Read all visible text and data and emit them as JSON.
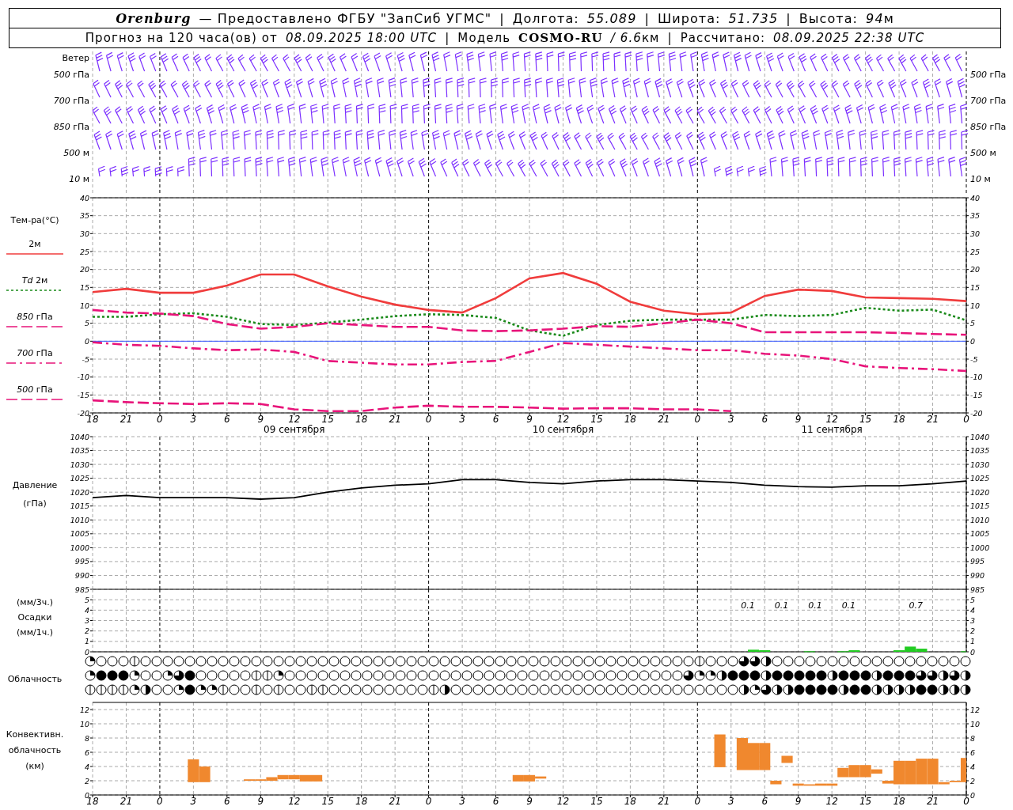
{
  "header": {
    "lines": [
      [
        {
          "kind": "station",
          "text": "Orenburg"
        },
        {
          "kind": "text",
          "text": "— Предоставлено ФГБУ \"ЗапСиб УГМС\""
        },
        {
          "kind": "separator",
          "text": "|"
        },
        {
          "kind": "text",
          "text": "Долгота:"
        },
        {
          "kind": "value",
          "text": "55.089"
        },
        {
          "kind": "separator",
          "text": "|"
        },
        {
          "kind": "text",
          "text": "Широта:"
        },
        {
          "kind": "value",
          "text": "51.735"
        },
        {
          "kind": "separator",
          "text": "|"
        },
        {
          "kind": "text",
          "text": "Высота:"
        },
        {
          "kind": "value",
          "text": "94"
        },
        {
          "kind": "unit",
          "text": "м"
        }
      ],
      [
        {
          "kind": "text",
          "text": "Прогноз на 120 часа(ов) от"
        },
        {
          "kind": "value",
          "text": "08.09.2025 18:00 UTC"
        },
        {
          "kind": "separator",
          "text": "|"
        },
        {
          "kind": "text",
          "text": "Модель"
        },
        {
          "kind": "model",
          "text": "COSMO-RU"
        },
        {
          "kind": "value",
          "text": "/ 6.6"
        },
        {
          "kind": "unit",
          "text": "км"
        },
        {
          "kind": "separator",
          "text": "|"
        },
        {
          "kind": "text",
          "text": "Рассчитано:"
        },
        {
          "kind": "value",
          "text": "08.09.2025 22:38 UTC"
        }
      ]
    ]
  },
  "wind": {
    "title": "Ветер",
    "levels": [
      "*500* гПа",
      "*700* гПа",
      "*850* гПа",
      "*500* м",
      "*10* м"
    ],
    "right_levels": [
      "*500* гПа",
      "*700* гПа",
      "*850* гПа",
      "*500* м",
      "*10* м"
    ]
  },
  "temperature": {
    "left_axis": [
      "40",
      "35",
      "30",
      "25",
      "20",
      "15",
      "10",
      "5",
      "0",
      "-5",
      "-10",
      "-15",
      "-20"
    ],
    "right_axis": [
      "40",
      "35",
      "30",
      "25",
      "20",
      "15",
      "10",
      "5",
      "0",
      "-5",
      "-10",
      "-15",
      "-20"
    ],
    "chart_data": {
      "type": "line",
      "title": "Тем-ра(°C)",
      "categories": [
        "18",
        "21",
        "0",
        "3",
        "6",
        "9",
        "12",
        "15",
        "18",
        "21",
        "0",
        "3",
        "6",
        "9",
        "12",
        "15",
        "18",
        "21",
        "0",
        "3",
        "6",
        "9",
        "12",
        "15",
        "18",
        "21",
        "0"
      ],
      "ylim": [
        -20,
        40
      ],
      "series": [
        {
          "name": "2м",
          "line_style": "solid",
          "color": "#f03c3c",
          "values": [
            13.7,
            14.6,
            13.5,
            13.5,
            15.5,
            18.6,
            18.6,
            15.3,
            12.4,
            10.2,
            8.7,
            8,
            12,
            17.5,
            19,
            16,
            11,
            8.5,
            7.5,
            8,
            12.6,
            14.4,
            14,
            12.2,
            12,
            11.8,
            11.2
          ]
        },
        {
          "name": "*Td* 2м",
          "line_style": "dotted",
          "color": "#1a8a1a",
          "values": [
            6.8,
            6.8,
            7.5,
            7.8,
            6.8,
            4.8,
            4.5,
            5.2,
            6,
            7,
            7.5,
            7.3,
            6.5,
            3,
            1.5,
            4.5,
            5.7,
            6,
            6,
            6,
            7.3,
            7,
            7.3,
            9.3,
            8.5,
            8.8,
            5.8
          ]
        },
        {
          "name": "*850* гПа",
          "line_style": "dashed",
          "color": "#e8147a",
          "values": [
            8.7,
            8,
            7.7,
            7,
            4.8,
            3.5,
            4,
            5,
            4.5,
            4,
            4,
            3,
            2.8,
            3,
            3.5,
            4.2,
            4,
            5,
            6,
            5,
            2.5,
            2.5,
            2.5,
            2.5,
            2.3,
            2,
            1.8
          ]
        },
        {
          "name": "*700* гПа",
          "line_style": "dashdot",
          "color": "#e8147a",
          "values": [
            -0.3,
            -1,
            -1.3,
            -2,
            -2.5,
            -2.3,
            -3,
            -5.5,
            -6,
            -6.5,
            -6.5,
            -5.8,
            -5.5,
            -3,
            -0.5,
            -1,
            -1.5,
            -2,
            -2.5,
            -2.5,
            -3.5,
            -4,
            -5,
            -7,
            -7.5,
            -7.8,
            -8.3
          ]
        },
        {
          "name": "*500* гПа",
          "line_style": "dashed",
          "color": "#e8147a",
          "values": [
            -16.5,
            -17,
            -17.3,
            -17.5,
            -17.3,
            -17.5,
            -19,
            -19.5,
            -19.5,
            -18.5,
            -18,
            -18.3,
            -18.3,
            -18.5,
            -18.8,
            -18.7,
            -18.7,
            -19,
            -19,
            -19.5,
            null,
            null,
            null,
            null,
            null,
            null,
            null
          ]
        }
      ],
      "yticks": [
        -20,
        -15,
        -10,
        -5,
        0,
        5,
        10,
        15,
        20,
        25,
        30,
        35,
        40
      ],
      "grid": true,
      "ref_lines": [
        {
          "axis": "y",
          "value": 0,
          "color": "#3355ff"
        }
      ],
      "annotations": [
        "09 сентября",
        "10 сентября",
        "11 сентября"
      ]
    }
  },
  "pressure": {
    "labels": [
      "Давление",
      "(гПа)"
    ],
    "right_axis": [
      "1040",
      "1035",
      "1030",
      "1025",
      "1020",
      "1015",
      "1010",
      "1005",
      "1000",
      "995",
      "990",
      "985"
    ],
    "chart_data": {
      "type": "line",
      "categories": [
        null,
        null,
        null,
        null,
        null,
        null,
        null,
        null,
        null,
        null,
        null,
        null,
        null,
        null,
        null,
        null,
        null,
        null,
        null,
        null,
        null,
        null,
        null,
        null,
        null,
        null,
        null
      ],
      "ylim": [
        985,
        1040
      ],
      "grid": true,
      "series": [
        {
          "color": "#000000",
          "values": [
            1018,
            1018.8,
            1018,
            1018,
            1018,
            1017.5,
            1018,
            1020,
            1021.5,
            1022.5,
            1023,
            1024.5,
            1024.5,
            1023.5,
            1023,
            1024,
            1024.5,
            1024.5,
            1024,
            1023.5,
            1022.5,
            1022,
            1021.8,
            1022.3,
            1022.3,
            1023,
            1024
          ]
        }
      ],
      "yticks": [
        985,
        990,
        995,
        1000,
        1005,
        1010,
        1015,
        1020,
        1025,
        1030,
        1035,
        1040
      ]
    }
  },
  "precipitation": {
    "labels": [
      "(мм/3ч.)",
      "Осадки",
      "(мм/1ч.)"
    ],
    "right_axis": [
      "5",
      "4",
      "3",
      "2",
      "1",
      "0"
    ],
    "chart_data": {
      "type": "bar",
      "categories": [
        null,
        null,
        null,
        null,
        null,
        null,
        null,
        null,
        null,
        null,
        null,
        null,
        null,
        null,
        null,
        null,
        null,
        null,
        null,
        null,
        null,
        null,
        null,
        null,
        null,
        null,
        null,
        null,
        null,
        null,
        null,
        null,
        null,
        null,
        null,
        null,
        null,
        null,
        null,
        null,
        null,
        null,
        null,
        null,
        null,
        null,
        null,
        null,
        null,
        null,
        null,
        null,
        null,
        null,
        null,
        null,
        null,
        null,
        null,
        null,
        null,
        null,
        null,
        null,
        null,
        null,
        null,
        null,
        null,
        null,
        null,
        null,
        null,
        null,
        null,
        null,
        null,
        null,
        null
      ],
      "ylim": [
        0,
        6
      ],
      "grid": true,
      "series": [
        {
          "color": "#22cc22",
          "values": [
            0,
            0,
            0,
            0,
            0,
            0,
            0,
            0,
            0,
            0,
            0,
            0,
            0,
            0,
            0,
            0,
            0,
            0,
            0,
            0,
            0,
            0,
            0,
            0,
            0,
            0,
            0,
            0,
            0,
            0,
            0,
            0,
            0,
            0,
            0,
            0,
            0,
            0,
            0,
            0,
            0,
            0,
            0,
            0,
            0,
            0,
            0,
            0,
            0,
            0,
            0,
            0,
            0,
            0,
            0,
            0,
            0,
            0,
            0,
            0.2,
            0.15,
            0,
            0,
            0,
            0.05,
            0,
            0,
            0.05,
            0.15,
            0,
            0,
            0,
            0.15,
            0.5,
            0.3,
            0,
            0,
            0,
            0.05
          ]
        }
      ],
      "yticks": [
        0,
        1,
        2,
        3,
        4,
        5
      ],
      "annotations": [
        "0.1",
        "0.1",
        "0.1",
        "0.1",
        "0.7"
      ]
    }
  },
  "clouds": {
    "label": "Облачность",
    "rows": [
      {
        "cells": [
          {
            "kind": "quarter"
          },
          {
            "kind": "clear"
          },
          {
            "kind": "clear"
          },
          {
            "kind": "clear"
          },
          {
            "kind": "few"
          },
          {
            "kind": "clear"
          },
          {
            "kind": "clear"
          },
          {
            "kind": "clear"
          },
          {
            "kind": "clear"
          },
          {
            "kind": "clear"
          },
          {
            "kind": "clear"
          },
          {
            "kind": "clear"
          },
          {
            "kind": "clear"
          },
          {
            "kind": "clear"
          },
          {
            "kind": "clear"
          },
          {
            "kind": "clear"
          },
          {
            "kind": "clear"
          },
          {
            "kind": "clear"
          },
          {
            "kind": "clear"
          },
          {
            "kind": "clear"
          },
          {
            "kind": "clear"
          },
          {
            "kind": "clear"
          },
          {
            "kind": "clear"
          },
          {
            "kind": "clear"
          },
          {
            "kind": "clear"
          },
          {
            "kind": "clear"
          },
          {
            "kind": "clear"
          },
          {
            "kind": "clear"
          },
          {
            "kind": "clear"
          },
          {
            "kind": "clear"
          },
          {
            "kind": "clear"
          },
          {
            "kind": "clear"
          },
          {
            "kind": "clear"
          },
          {
            "kind": "clear"
          },
          {
            "kind": "clear"
          },
          {
            "kind": "clear"
          },
          {
            "kind": "clear"
          },
          {
            "kind": "clear"
          },
          {
            "kind": "clear"
          },
          {
            "kind": "clear"
          },
          {
            "kind": "clear"
          },
          {
            "kind": "clear"
          },
          {
            "kind": "clear"
          },
          {
            "kind": "clear"
          },
          {
            "kind": "clear"
          },
          {
            "kind": "clear"
          },
          {
            "kind": "clear"
          },
          {
            "kind": "clear"
          },
          {
            "kind": "clear"
          },
          {
            "kind": "clear"
          },
          {
            "kind": "clear"
          },
          {
            "kind": "clear"
          },
          {
            "kind": "clear"
          },
          {
            "kind": "clear"
          },
          {
            "kind": "clear"
          },
          {
            "kind": "few"
          },
          {
            "kind": "clear"
          },
          {
            "kind": "clear"
          },
          {
            "kind": "clear"
          },
          {
            "kind": "mostly"
          },
          {
            "kind": "mostly"
          },
          {
            "kind": "half"
          },
          {
            "kind": "clear"
          },
          {
            "kind": "clear"
          },
          {
            "kind": "clear"
          },
          {
            "kind": "clear"
          },
          {
            "kind": "clear"
          },
          {
            "kind": "clear"
          },
          {
            "kind": "clear"
          },
          {
            "kind": "clear"
          },
          {
            "kind": "clear"
          },
          {
            "kind": "clear"
          },
          {
            "kind": "clear"
          },
          {
            "kind": "clear"
          },
          {
            "kind": "clear"
          },
          {
            "kind": "clear"
          },
          {
            "kind": "clear"
          },
          {
            "kind": "clear"
          },
          {
            "kind": "clear"
          },
          {
            "kind": "clear"
          }
        ]
      },
      {
        "cells": [
          {
            "kind": "quarter"
          },
          {
            "kind": "overcast"
          },
          {
            "kind": "overcast"
          },
          {
            "kind": "overcast"
          },
          {
            "kind": "quarter"
          },
          {
            "kind": "clear"
          },
          {
            "kind": "clear"
          },
          {
            "kind": "quarter"
          },
          {
            "kind": "mostly"
          },
          {
            "kind": "overcast"
          },
          {
            "kind": "clear"
          },
          {
            "kind": "clear"
          },
          {
            "kind": "clear"
          },
          {
            "kind": "clear"
          },
          {
            "kind": "clear"
          },
          {
            "kind": "few"
          },
          {
            "kind": "few"
          },
          {
            "kind": "quarter"
          },
          {
            "kind": "clear"
          },
          {
            "kind": "clear"
          },
          {
            "kind": "clear"
          },
          {
            "kind": "clear"
          },
          {
            "kind": "clear"
          },
          {
            "kind": "clear"
          },
          {
            "kind": "clear"
          },
          {
            "kind": "clear"
          },
          {
            "kind": "clear"
          },
          {
            "kind": "clear"
          },
          {
            "kind": "clear"
          },
          {
            "kind": "clear"
          },
          {
            "kind": "clear"
          },
          {
            "kind": "clear"
          },
          {
            "kind": "clear"
          },
          {
            "kind": "clear"
          },
          {
            "kind": "clear"
          },
          {
            "kind": "clear"
          },
          {
            "kind": "clear"
          },
          {
            "kind": "clear"
          },
          {
            "kind": "clear"
          },
          {
            "kind": "clear"
          },
          {
            "kind": "clear"
          },
          {
            "kind": "clear"
          },
          {
            "kind": "clear"
          },
          {
            "kind": "clear"
          },
          {
            "kind": "clear"
          },
          {
            "kind": "clear"
          },
          {
            "kind": "clear"
          },
          {
            "kind": "clear"
          },
          {
            "kind": "clear"
          },
          {
            "kind": "clear"
          },
          {
            "kind": "clear"
          },
          {
            "kind": "clear"
          },
          {
            "kind": "clear"
          },
          {
            "kind": "clear"
          },
          {
            "kind": "mostly"
          },
          {
            "kind": "quarter"
          },
          {
            "kind": "quarter"
          },
          {
            "kind": "half"
          },
          {
            "kind": "overcast"
          },
          {
            "kind": "overcast"
          },
          {
            "kind": "overcast"
          },
          {
            "kind": "half"
          },
          {
            "kind": "overcast"
          },
          {
            "kind": "overcast"
          },
          {
            "kind": "overcast"
          },
          {
            "kind": "overcast"
          },
          {
            "kind": "overcast"
          },
          {
            "kind": "half"
          },
          {
            "kind": "overcast"
          },
          {
            "kind": "overcast"
          },
          {
            "kind": "overcast"
          },
          {
            "kind": "half"
          },
          {
            "kind": "overcast"
          },
          {
            "kind": "overcast"
          },
          {
            "kind": "overcast"
          },
          {
            "kind": "mostly"
          },
          {
            "kind": "mostly"
          },
          {
            "kind": "half"
          },
          {
            "kind": "mostly"
          },
          {
            "kind": "half"
          }
        ]
      },
      {
        "cells": [
          {
            "kind": "few"
          },
          {
            "kind": "few"
          },
          {
            "kind": "few"
          },
          {
            "kind": "few"
          },
          {
            "kind": "quarter"
          },
          {
            "kind": "half"
          },
          {
            "kind": "clear"
          },
          {
            "kind": "clear"
          },
          {
            "kind": "quarter"
          },
          {
            "kind": "overcast"
          },
          {
            "kind": "quarter"
          },
          {
            "kind": "quarter"
          },
          {
            "kind": "few"
          },
          {
            "kind": "clear"
          },
          {
            "kind": "clear"
          },
          {
            "kind": "few"
          },
          {
            "kind": "clear"
          },
          {
            "kind": "few"
          },
          {
            "kind": "clear"
          },
          {
            "kind": "clear"
          },
          {
            "kind": "few"
          },
          {
            "kind": "few"
          },
          {
            "kind": "clear"
          },
          {
            "kind": "clear"
          },
          {
            "kind": "clear"
          },
          {
            "kind": "clear"
          },
          {
            "kind": "clear"
          },
          {
            "kind": "clear"
          },
          {
            "kind": "clear"
          },
          {
            "kind": "clear"
          },
          {
            "kind": "clear"
          },
          {
            "kind": "few"
          },
          {
            "kind": "half"
          },
          {
            "kind": "clear"
          },
          {
            "kind": "clear"
          },
          {
            "kind": "clear"
          },
          {
            "kind": "clear"
          },
          {
            "kind": "clear"
          },
          {
            "kind": "clear"
          },
          {
            "kind": "clear"
          },
          {
            "kind": "clear"
          },
          {
            "kind": "clear"
          },
          {
            "kind": "clear"
          },
          {
            "kind": "clear"
          },
          {
            "kind": "clear"
          },
          {
            "kind": "clear"
          },
          {
            "kind": "clear"
          },
          {
            "kind": "clear"
          },
          {
            "kind": "clear"
          },
          {
            "kind": "clear"
          },
          {
            "kind": "clear"
          },
          {
            "kind": "clear"
          },
          {
            "kind": "clear"
          },
          {
            "kind": "clear"
          },
          {
            "kind": "clear"
          },
          {
            "kind": "clear"
          },
          {
            "kind": "clear"
          },
          {
            "kind": "clear"
          },
          {
            "kind": "clear"
          },
          {
            "kind": "half"
          },
          {
            "kind": "quarter"
          },
          {
            "kind": "mostly"
          },
          {
            "kind": "half"
          },
          {
            "kind": "half"
          },
          {
            "kind": "overcast"
          },
          {
            "kind": "overcast"
          },
          {
            "kind": "overcast"
          },
          {
            "kind": "overcast"
          },
          {
            "kind": "half"
          },
          {
            "kind": "overcast"
          },
          {
            "kind": "overcast"
          },
          {
            "kind": "half"
          },
          {
            "kind": "half"
          },
          {
            "kind": "half"
          },
          {
            "kind": "half"
          },
          {
            "kind": "overcast"
          },
          {
            "kind": "overcast"
          },
          {
            "kind": "half"
          },
          {
            "kind": "half"
          },
          {
            "kind": "half"
          }
        ]
      }
    ]
  },
  "convective": {
    "labels": [
      "Конвективн.",
      "облачность",
      "(км)"
    ],
    "right_axis": [
      "12",
      "10",
      "8",
      "6",
      "4",
      "2",
      "0"
    ],
    "chart_data": {
      "type": "bar",
      "categories": [
        "18",
        null,
        null,
        "21",
        null,
        null,
        "0",
        null,
        null,
        "3",
        null,
        null,
        "6",
        null,
        null,
        "9",
        null,
        null,
        "12",
        null,
        null,
        "15",
        null,
        null,
        "18",
        null,
        null,
        "21",
        null,
        null,
        "0",
        null,
        null,
        "3",
        null,
        null,
        "6",
        null,
        null,
        "9",
        null,
        null,
        "12",
        null,
        null,
        "15",
        null,
        null,
        "18",
        null,
        null,
        "21",
        null,
        null,
        "0",
        null,
        null,
        "3",
        null,
        null,
        "6",
        null,
        null,
        "9",
        null,
        null,
        "12",
        null,
        null,
        "15",
        null,
        null,
        "18",
        null,
        null,
        "21",
        null,
        null,
        "0"
      ],
      "ylim": [
        0,
        13
      ],
      "series": [
        {
          "color": "#f0882e",
          "base": [
            null,
            null,
            null,
            null,
            null,
            null,
            null,
            null,
            null,
            1.8,
            1.8,
            null,
            null,
            null,
            2,
            2,
            2,
            2.2,
            2.2,
            1.9,
            1.9,
            null,
            null,
            null,
            null,
            null,
            null,
            null,
            null,
            null,
            null,
            null,
            null,
            null,
            null,
            null,
            null,
            null,
            1.9,
            1.9,
            2.3,
            null,
            null,
            null,
            null,
            null,
            null,
            null,
            null,
            null,
            null,
            null,
            null,
            null,
            null,
            null,
            3.9,
            null,
            3.5,
            3.5,
            3.5,
            1.5,
            4.5,
            1.3,
            1.3,
            1.3,
            1.3,
            2.5,
            2.5,
            2.5,
            3,
            1.6,
            1.5,
            1.5,
            1.5,
            1.5,
            1.5,
            1.8,
            1.8
          ],
          "values": [
            null,
            null,
            null,
            null,
            null,
            null,
            null,
            null,
            null,
            3.2,
            2.2,
            null,
            null,
            null,
            0.2,
            0.2,
            0.5,
            0.6,
            0.6,
            0.9,
            0.9,
            null,
            null,
            null,
            null,
            null,
            null,
            null,
            null,
            null,
            null,
            null,
            null,
            null,
            null,
            null,
            null,
            null,
            0.9,
            0.9,
            0.3,
            null,
            null,
            null,
            null,
            null,
            null,
            null,
            null,
            null,
            null,
            null,
            null,
            null,
            null,
            null,
            4.6,
            null,
            4.5,
            3.8,
            3.8,
            0.5,
            1,
            0.3,
            0.2,
            0.3,
            0.3,
            1.3,
            1.7,
            1.7,
            0.6,
            0.4,
            3.3,
            3.3,
            3.6,
            3.6,
            0.3,
            0.2,
            3.4
          ]
        }
      ],
      "yticks": [
        0,
        2,
        4,
        6,
        8,
        10,
        12
      ],
      "grid": true
    }
  }
}
